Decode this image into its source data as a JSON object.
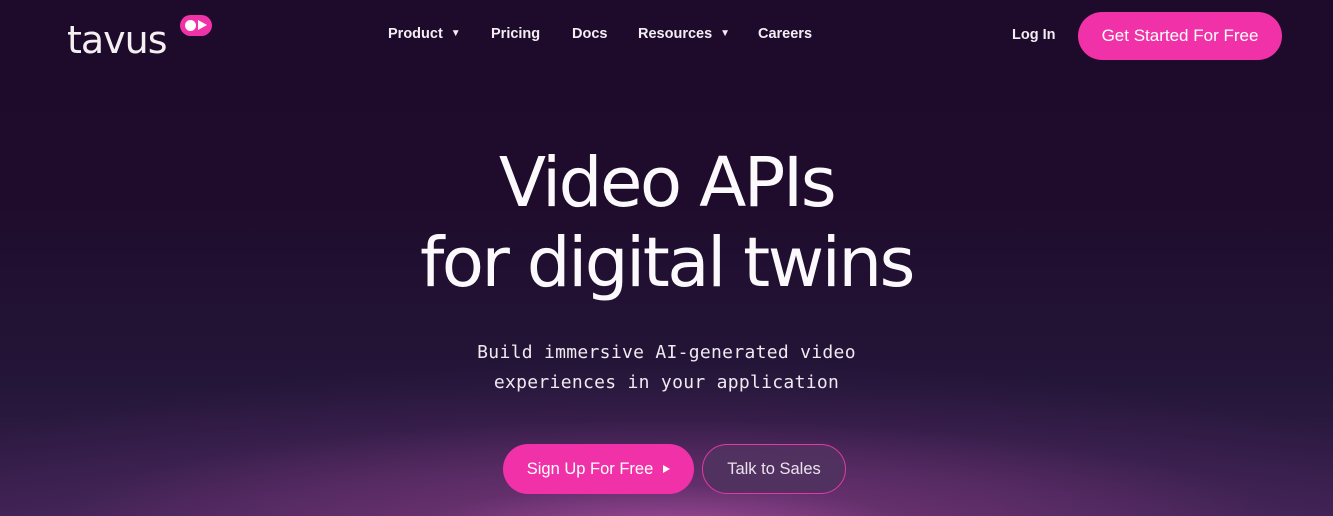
{
  "brand": {
    "name": "tavus",
    "accent_color": "#f131a8",
    "background_color": "#1e0b2a"
  },
  "nav": {
    "items": [
      {
        "label": "Product",
        "has_dropdown": true
      },
      {
        "label": "Pricing",
        "has_dropdown": false
      },
      {
        "label": "Docs",
        "has_dropdown": false
      },
      {
        "label": "Resources",
        "has_dropdown": true
      },
      {
        "label": "Careers",
        "has_dropdown": false
      }
    ],
    "dropdown_icon": "▼",
    "login_label": "Log In",
    "cta_label": "Get Started For Free"
  },
  "hero": {
    "title_line1": "Video APIs",
    "title_line2": "for digital twins",
    "subtitle_line1": "Build immersive AI-generated video",
    "subtitle_line2": "experiences in your application",
    "primary_button": "Sign Up For Free",
    "secondary_button": "Talk to Sales"
  }
}
